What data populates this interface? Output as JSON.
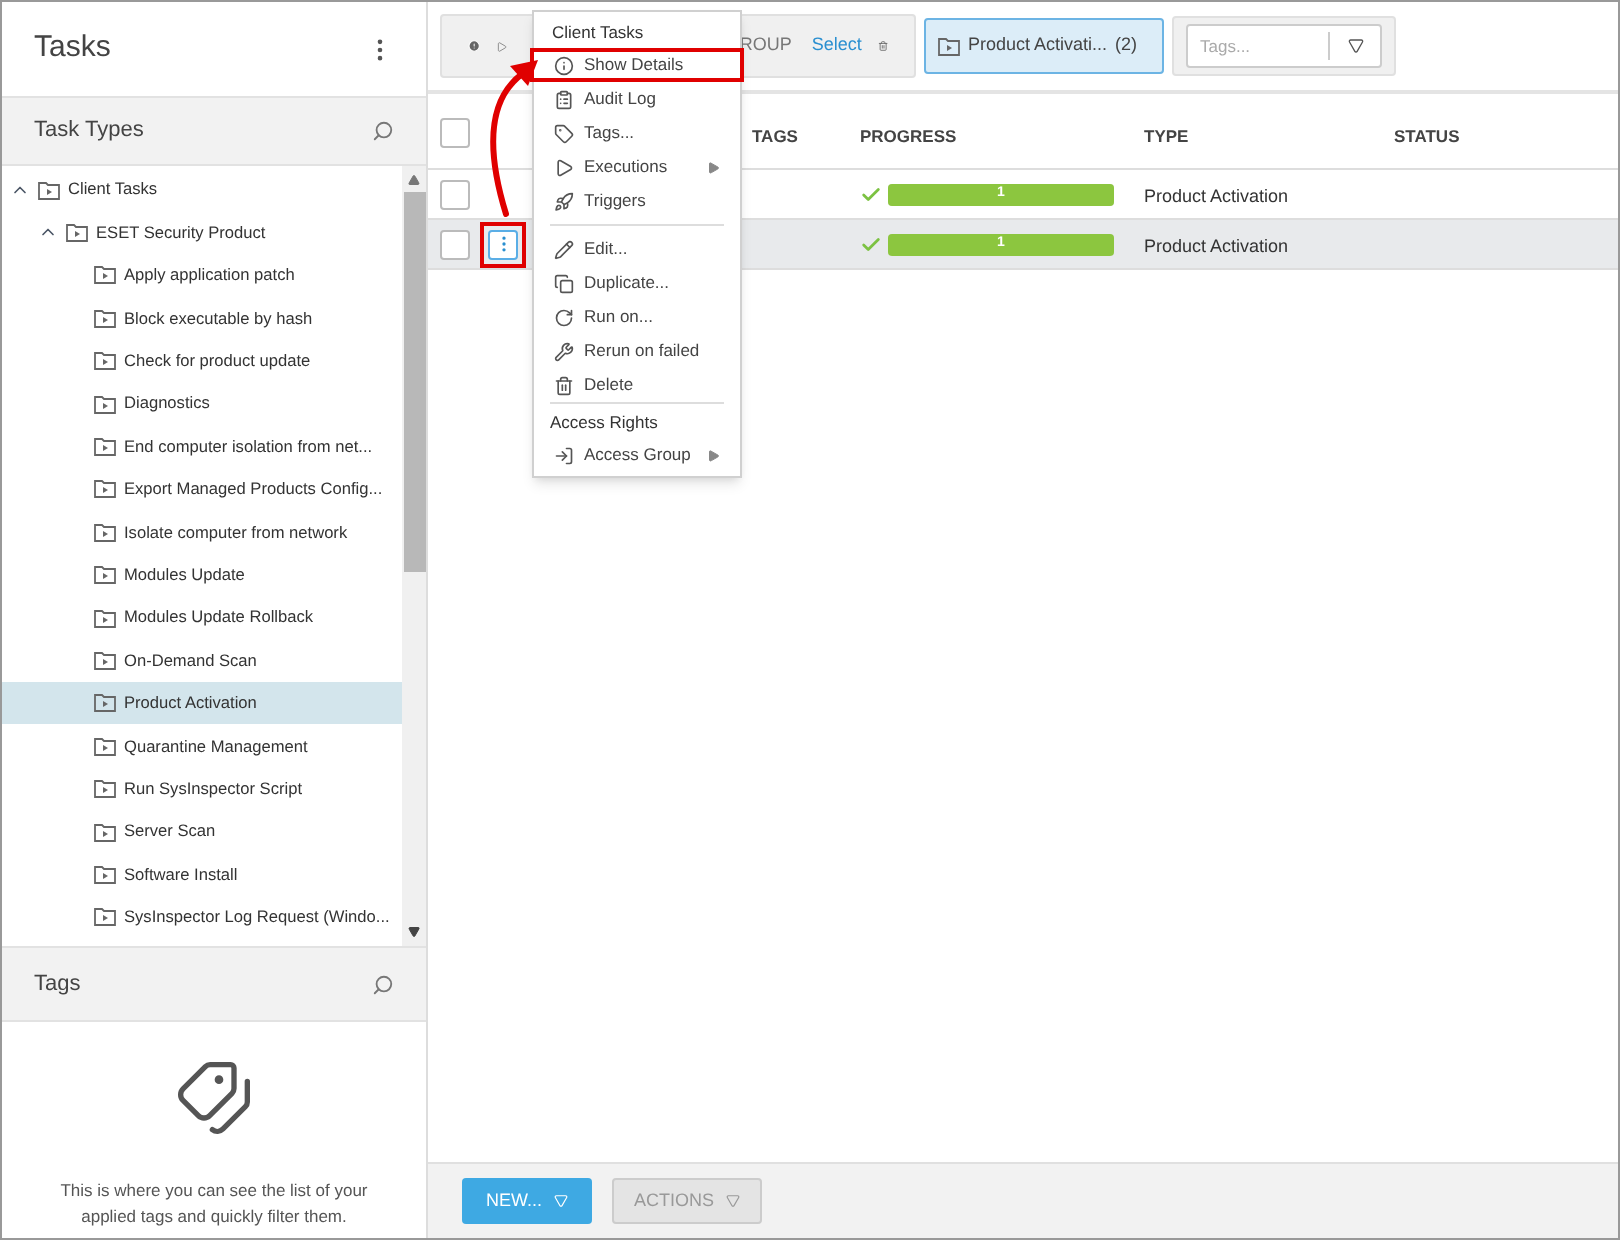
{
  "sidebar": {
    "title": "Tasks",
    "task_types": {
      "title": "Task Types",
      "tree": [
        {
          "label": "Client Tasks",
          "expanded": true,
          "selected": false,
          "children": [
            {
              "label": "ESET Security Product",
              "expanded": true,
              "selected": false,
              "children": [
                {
                  "label": "Apply application patch",
                  "selected": false
                },
                {
                  "label": "Block executable by hash",
                  "selected": false
                },
                {
                  "label": "Check for product update",
                  "selected": false
                },
                {
                  "label": "Diagnostics",
                  "selected": false
                },
                {
                  "label": "End computer isolation from net...",
                  "selected": false
                },
                {
                  "label": "Export Managed Products Config...",
                  "selected": false
                },
                {
                  "label": "Isolate computer from network",
                  "selected": false
                },
                {
                  "label": "Modules Update",
                  "selected": false
                },
                {
                  "label": "Modules Update Rollback",
                  "selected": false
                },
                {
                  "label": "On-Demand Scan",
                  "selected": false
                },
                {
                  "label": "Product Activation",
                  "selected": true
                },
                {
                  "label": "Quarantine Management",
                  "selected": false
                },
                {
                  "label": "Run SysInspector Script",
                  "selected": false
                },
                {
                  "label": "Server Scan",
                  "selected": false
                },
                {
                  "label": "Software Install",
                  "selected": false
                },
                {
                  "label": "SysInspector Log Request (Windo...",
                  "selected": false
                }
              ]
            }
          ]
        }
      ]
    },
    "tags": {
      "title": "Tags",
      "empty_message": "This is where you can see the list of your applied tags and quickly filter them."
    }
  },
  "toolbar": {
    "filter_text": "ROUP",
    "select_link": "Select",
    "chip": {
      "label": "Product Activati...",
      "count": "(2)"
    },
    "tags_field": {
      "placeholder": "Tags..."
    }
  },
  "table": {
    "header_checked": false,
    "columns": [
      "TAGS",
      "PROGRESS",
      "TYPE",
      "STATUS"
    ],
    "rows": [
      {
        "checked": false,
        "selected": false,
        "progress": "1",
        "level": 1,
        "type": "Product Activation"
      },
      {
        "checked": false,
        "selected": true,
        "progress": "1",
        "level": 1,
        "type": "Product Activation",
        "actions_annotated": true
      }
    ]
  },
  "context_menu": {
    "sections": [
      {
        "title": "Client Tasks",
        "groups": [
          [
            {
              "label": "Show Details",
              "submenu": false,
              "annotated": true
            },
            {
              "label": "Audit Log",
              "submenu": false,
              "annotated": false
            },
            {
              "label": "Tags...",
              "submenu": false,
              "annotated": false
            },
            {
              "label": "Executions",
              "submenu": true,
              "annotated": false
            },
            {
              "label": "Triggers",
              "submenu": false,
              "annotated": false
            }
          ],
          [
            {
              "label": "Edit...",
              "submenu": false,
              "annotated": false
            },
            {
              "label": "Duplicate...",
              "submenu": false,
              "annotated": false
            },
            {
              "label": "Run on...",
              "submenu": false,
              "annotated": false
            },
            {
              "label": "Rerun on failed",
              "submenu": false,
              "annotated": false
            },
            {
              "label": "Delete",
              "submenu": false,
              "annotated": false
            }
          ]
        ]
      },
      {
        "title": "Access Rights",
        "groups": [
          [
            {
              "label": "Access Group",
              "submenu": true,
              "annotated": false
            }
          ]
        ]
      }
    ]
  },
  "bottom_bar": {
    "new_button": "NEW...",
    "actions_button": "ACTIONS"
  }
}
